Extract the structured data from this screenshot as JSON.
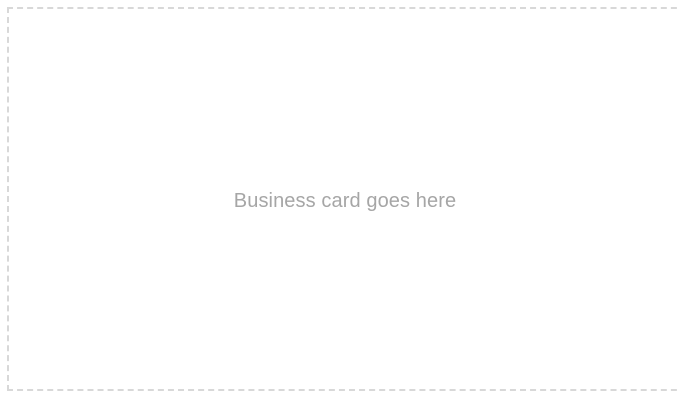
{
  "business_card_placeholder": {
    "text": "Business card goes here",
    "border_color": "#d8d8d8",
    "text_color": "#a6a6a6"
  }
}
